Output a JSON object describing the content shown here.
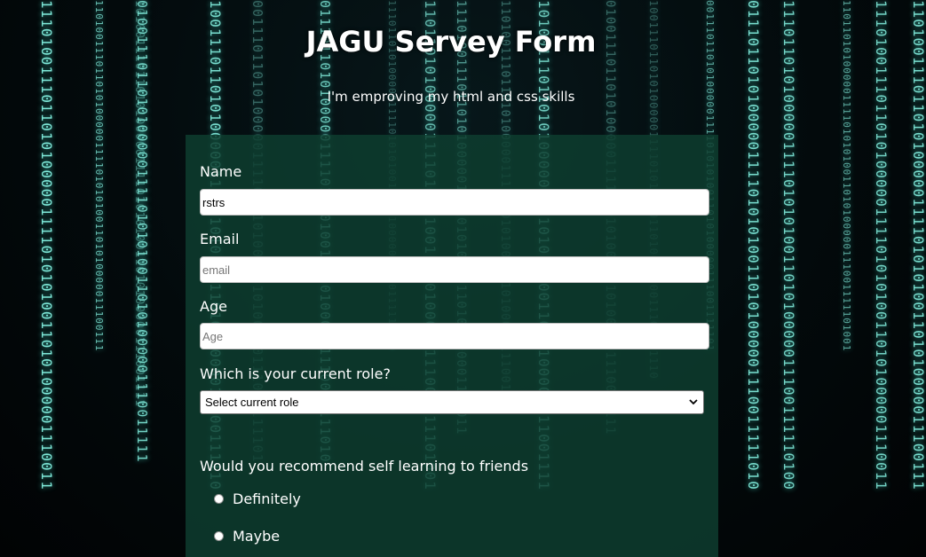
{
  "header": {
    "title": "JAGU Servey Form",
    "description": "I'm emproving my html and css skills"
  },
  "form": {
    "name": {
      "label": "Name",
      "value": "rstrs",
      "placeholder": ""
    },
    "email": {
      "label": "Email",
      "value": "",
      "placeholder": "email"
    },
    "age": {
      "label": "Age",
      "value": "",
      "placeholder": "Age"
    },
    "role": {
      "label": "Which is your current role?",
      "selected": "Select current role"
    },
    "recommend": {
      "question": "Would you recommend self learning to friends",
      "options": [
        "Definitely",
        "Maybe"
      ]
    }
  },
  "background": {
    "theme": "binary-matrix",
    "glow_color": "#7fe9d9",
    "panel_color": "#0e3e30"
  }
}
